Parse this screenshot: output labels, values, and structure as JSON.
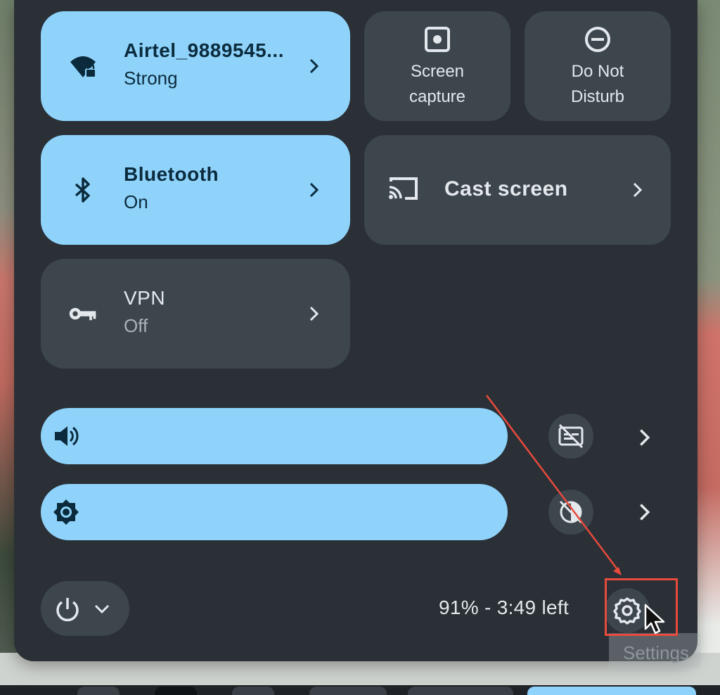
{
  "tiles": {
    "wifi": {
      "title": "Airtel_9889545...",
      "status": "Strong"
    },
    "bluetooth": {
      "title": "Bluetooth",
      "status": "On"
    },
    "vpn": {
      "title": "VPN",
      "status": "Off"
    }
  },
  "feature_tiles": {
    "screen_capture": {
      "line1": "Screen",
      "line2": "capture"
    },
    "do_not_disturb": {
      "line1": "Do Not",
      "line2": "Disturb"
    },
    "cast": {
      "label": "Cast screen"
    }
  },
  "sliders": {
    "volume": {
      "icon": "volume-icon"
    },
    "brightness": {
      "icon": "brightness-icon"
    }
  },
  "footer": {
    "battery_text": "91% - 3:49 left",
    "settings_tooltip": "Settings"
  },
  "colors": {
    "active_tile": "#8fd3fb",
    "inactive_tile": "#3d454d",
    "panel": "#2a3036",
    "annotation": "#e84a3c"
  }
}
